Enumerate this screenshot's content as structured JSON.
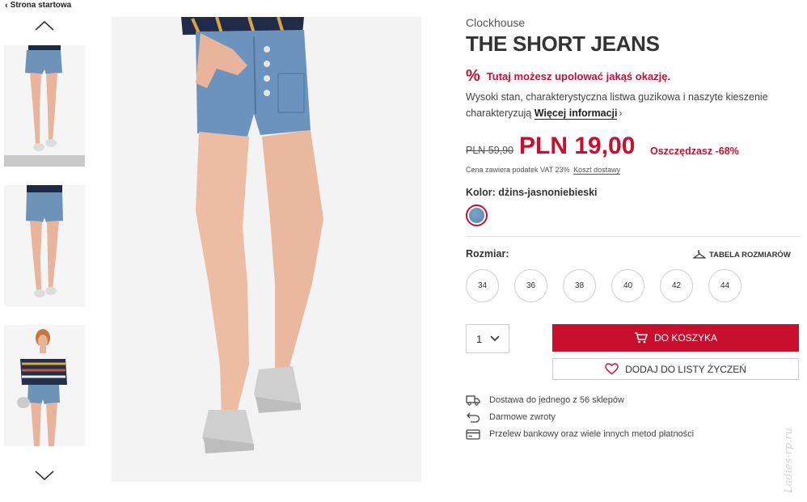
{
  "breadcrumb": {
    "label": "Strona startowa"
  },
  "product": {
    "brand": "Clockhouse",
    "title": "THE SHORT JEANS",
    "promo": "Tutaj możesz upolować jakąś okazję.",
    "description": "Wysoki stan, charakterystyczna listwa guzikowa i naszyte kieszenie charakteryzują",
    "more_info": "Więcej informacji",
    "old_price": "PLN 59,90",
    "new_price": "PLN 19,00",
    "savings": "Oszczędzasz -68%",
    "vat_note": "Cena zawiera podatek VAT 23%",
    "shipping_link": "Koszt dostawy",
    "color_label": "Kolor: dżins-jasnoniebieski",
    "size_label": "Rozmiar:",
    "size_table": "TABELA ROZMIARÓW",
    "sizes": [
      "34",
      "36",
      "38",
      "40",
      "42",
      "44"
    ],
    "quantity": "1",
    "add_to_cart": "DO KOSZYKA",
    "add_to_wishlist": "DODAJ DO LISTY ŻYCZEŃ"
  },
  "info": [
    {
      "icon": "truck-icon",
      "text": "Dostawa do jednego z 56 sklepów"
    },
    {
      "icon": "return-icon",
      "text": "Darmowe zwroty"
    },
    {
      "icon": "card-icon",
      "text": "Przelew bankowy oraz wiele innych metod płatności"
    }
  ],
  "watermark": "Ladies-rp.ru",
  "colors": {
    "accent": "#c8102e",
    "swatch": "#6e93b9"
  }
}
